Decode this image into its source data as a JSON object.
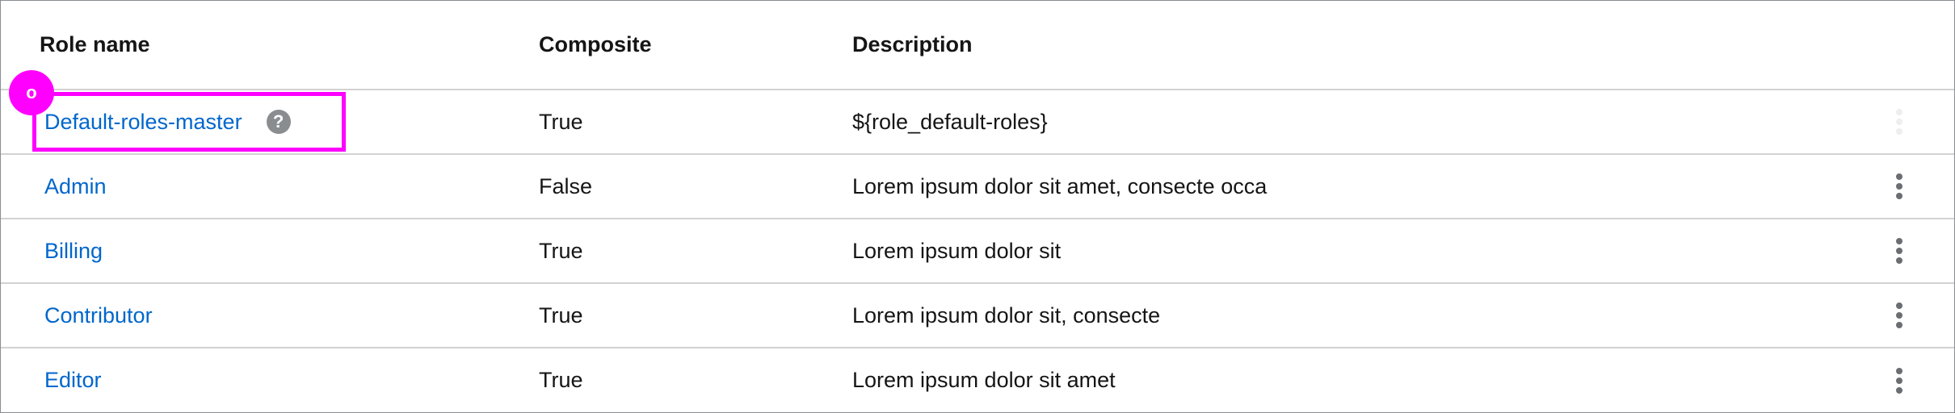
{
  "table": {
    "headers": {
      "role_name": "Role name",
      "composite": "Composite",
      "description": "Description"
    },
    "rows": [
      {
        "name": "Default-roles-master",
        "composite": "True",
        "description": "${role_default-roles}",
        "has_help": true,
        "help_glyph": "?",
        "actions_enabled": false
      },
      {
        "name": "Admin",
        "composite": "False",
        "description": "Lorem ipsum dolor sit amet, consecte occa",
        "actions_enabled": true
      },
      {
        "name": "Billing",
        "composite": "True",
        "description": "Lorem ipsum dolor sit",
        "actions_enabled": true
      },
      {
        "name": "Contributor",
        "composite": "True",
        "description": "Lorem ipsum dolor sit, consecte",
        "actions_enabled": true
      },
      {
        "name": "Editor",
        "composite": "True",
        "description": "Lorem ipsum dolor sit amet",
        "actions_enabled": true
      }
    ]
  },
  "annotation": {
    "marker_label": "o",
    "color": "#ff00ff"
  },
  "colors": {
    "link": "#0066cc",
    "text": "#151515",
    "divider": "#d2d2d2",
    "icon": "#8a8d90",
    "kebab": "#6a6e73"
  },
  "icons": {
    "help": "question-circle-icon",
    "actions": "kebab-menu-icon"
  }
}
